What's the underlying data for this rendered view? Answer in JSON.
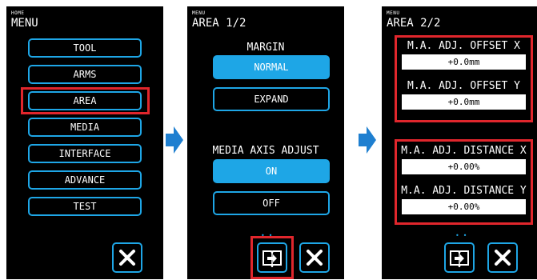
{
  "screen1": {
    "breadcrumb": "HOME",
    "title": "MENU",
    "items": [
      "TOOL",
      "ARMS",
      "AREA",
      "MEDIA",
      "INTERFACE",
      "ADVANCE",
      "TEST"
    ]
  },
  "screen2": {
    "breadcrumb": "MENU",
    "title": "AREA 1/2",
    "margin_label": "MARGIN",
    "margin_options": [
      "NORMAL",
      "EXPAND"
    ],
    "media_axis_label": "MEDIA AXIS ADJUST",
    "media_axis_options": [
      "ON",
      "OFF"
    ]
  },
  "screen3": {
    "breadcrumb": "MENU",
    "title": "AREA 2/2",
    "offset_x_label": "M.A. ADJ. OFFSET X",
    "offset_x_value": "+0.0mm",
    "offset_y_label": "M.A. ADJ. OFFSET Y",
    "offset_y_value": "+0.0mm",
    "distance_x_label": "M.A. ADJ. DISTANCE X",
    "distance_x_value": "+0.00%",
    "distance_y_label": "M.A. ADJ. DISTANCE Y",
    "distance_y_value": "+0.00%"
  },
  "icons": {
    "close": "close-icon",
    "page": "book-arrow-icon",
    "next_step": "next-arrow-icon"
  },
  "colors": {
    "accent": "#1ea6e6",
    "highlight": "#e0262c",
    "screen_bg": "#000000"
  }
}
